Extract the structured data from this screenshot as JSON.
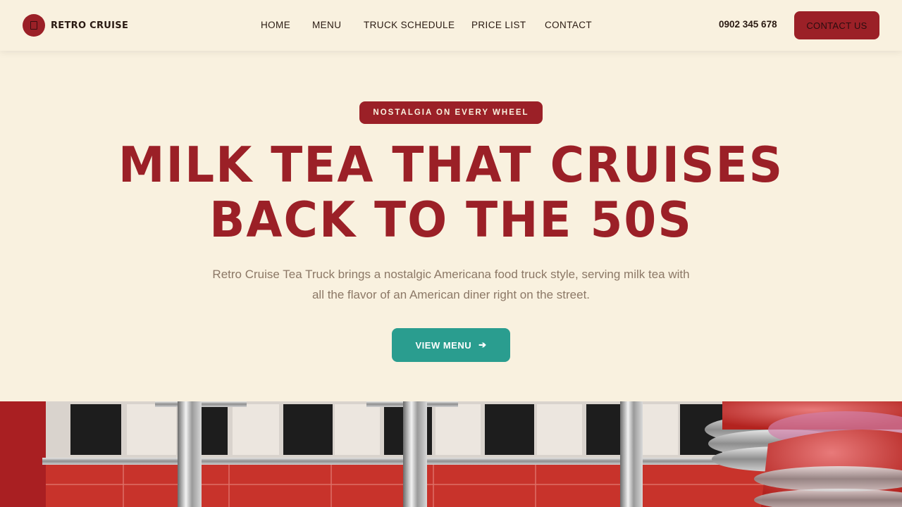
{
  "brand": {
    "name": "RETRO CRUISE",
    "logo_icon": "truck-icon"
  },
  "nav": {
    "items": [
      "HOME",
      "MENU",
      "TRUCK SCHEDULE",
      "PRICE LIST",
      "CONTACT"
    ]
  },
  "header": {
    "phone": "0902 345 678",
    "contact_label": "CONTACT US"
  },
  "hero": {
    "tagline": "NOSTALGIA ON EVERY WHEEL",
    "headline_line1": "MILK TEA THAT CRUISES",
    "headline_line2": "BACK TO THE 50S",
    "subtitle": "Retro Cruise Tea Truck brings a nostalgic Americana food truck style, serving milk tea with all the flavor of an American diner right on the street.",
    "cta_label": "VIEW MENU",
    "cta_icon": "arrow-right-icon"
  },
  "colors": {
    "background": "#f9f1df",
    "brand_red": "#9b2027",
    "teal": "#2a9d8f",
    "text_dark": "#2a1a12",
    "text_muted": "#8c7866"
  }
}
